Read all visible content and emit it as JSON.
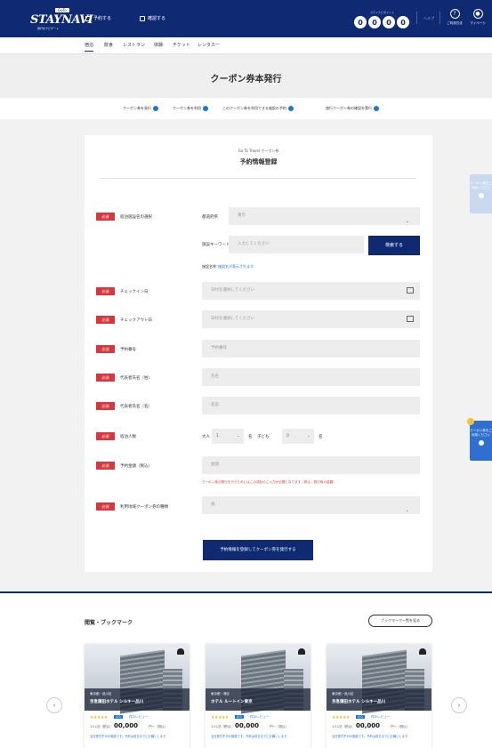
{
  "header": {
    "logo_main": "STAYNAVI",
    "logo_tag": "GoTo",
    "logo_sub": "旅行をナビゲート",
    "nav": [
      "予約する",
      "確認する"
    ],
    "points_label": "ステイナビポイント",
    "points_digits": [
      "0",
      "0",
      "0",
      "0"
    ],
    "link": "ヘルプ",
    "icons": [
      {
        "glyph": "?",
        "label": "ご利用方法"
      },
      {
        "glyph": "●",
        "label": "マイページ"
      }
    ]
  },
  "subnav": [
    "宿泊",
    "飲食",
    "レストラン",
    "体験",
    "チケット",
    "レンタカー"
  ],
  "page_title": "クーポン券本発行",
  "steps": [
    "クーポン券を発行",
    "クーポン券を利用",
    "このクーポン券を利用できる施設の予約",
    "旅行クーポン券の確認を実行"
  ],
  "form": {
    "caption": "Go To Travel クーポン券",
    "title": "予約情報登録",
    "required": "必須",
    "fields": {
      "facility": {
        "label": "宿泊施設名の選択",
        "sub1": "都道府県",
        "select": "東京",
        "sub2": "施設キーワード",
        "keyword_placeholder": "入力してください",
        "search_btn": "検索する",
        "result_label": "施設名称：",
        "result_link": "施設名が表示されます"
      },
      "checkin": {
        "label": "チェックイン日",
        "placeholder": "日付を選択してください"
      },
      "checkout": {
        "label": "チェックアウト日",
        "placeholder": "日付を選択してください"
      },
      "booking_no": {
        "label": "予約番号",
        "placeholder": "予約番号"
      },
      "name_sei": {
        "label": "代表者氏名（姓）",
        "placeholder": "氏名"
      },
      "name_mei": {
        "label": "代表者氏名（名）",
        "placeholder": "名前"
      },
      "guests": {
        "label": "宿泊人数",
        "adult_label": "大人",
        "adult_value": "1",
        "adult_unit": "名",
        "child_label": "子ども",
        "child_value": "0",
        "child_unit": "名"
      },
      "amount": {
        "label": "予約金額（税込）",
        "placeholder": "金額",
        "note": "クーポン券の発行を行うためにはこの項目のご入力が必要となります（税込・割引後の金額）"
      },
      "coupon_type": {
        "label": "利用地域クーポン券の種類",
        "value": "紙"
      }
    },
    "submit": "予約情報を登録してクーポン券を発行する"
  },
  "floating": [
    {
      "text": "クーポン券をご利用ください"
    },
    {
      "text": "クーポン券をご利用ください"
    },
    {
      "text": "クーポン券をご利用ください"
    }
  ],
  "history": {
    "title": "閲覧・ブックマーク",
    "more": "ブックマーク一覧を見る",
    "cards": [
      {
        "area": "東京都・品川区",
        "name": "京急蒲田ホテル シルキー品川",
        "reviews": "件のレビュー",
        "price_label": "1人1泊（税込）",
        "price": "00,000",
        "unit": "円〜（税込）",
        "plan": "当日受付不可の施設です。予約は前日までにお願いします"
      },
      {
        "area": "東京都・港区",
        "name": "ホテル ルートイン東京",
        "reviews": "件のレビュー",
        "price_label": "1人1泊（税込）",
        "price": "00,000",
        "unit": "円〜（税込）",
        "plan": "当日受付不可の施設です。予約は前日までにお願いします"
      },
      {
        "area": "東京都・品川区",
        "name": "京急蒲田ホテル シルキー品川",
        "reviews": "件のレビュー",
        "price_label": "1人1泊（税込）",
        "price": "00,000",
        "unit": "円〜（税込）",
        "plan": "当日受付不可の施設です。予約は前日までにお願いします"
      }
    ],
    "prev": "‹",
    "next": "›"
  }
}
